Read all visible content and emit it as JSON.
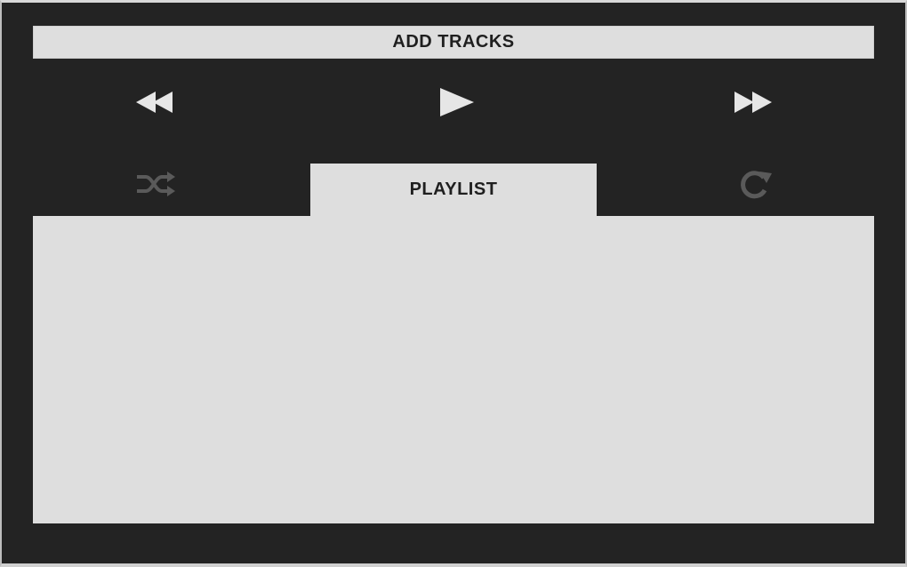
{
  "toolbar": {
    "add_tracks_label": "ADD TRACKS"
  },
  "controls": {
    "rewind": "rewind-icon",
    "play": "play-icon",
    "fast_forward": "fast-forward-icon",
    "shuffle": "shuffle-icon",
    "repeat": "repeat-icon"
  },
  "tabs": [
    {
      "label": "PLAYLIST"
    }
  ],
  "colors": {
    "background": "#232323",
    "panel": "#dedede",
    "icon_active": "#e6e6e6",
    "icon_inactive": "#5a5a5a",
    "text": "#1f1f1f"
  }
}
